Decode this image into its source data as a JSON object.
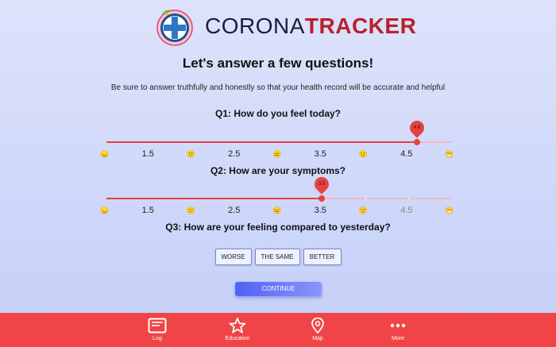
{
  "brand": {
    "part1": "CORONA",
    "part2": "TRACKER"
  },
  "heading": "Let's answer a few questions!",
  "subtitle": "Be sure to answer truthfully and honestly so that your health record will be accurate and helpful",
  "questions": [
    {
      "title": "Q1: How do you feel today?",
      "value": 4.6,
      "value_label": "4.6",
      "min": 1,
      "max": 5,
      "labels": [
        "😞",
        "1.5",
        "🙁",
        "2.5",
        "😐",
        "3.5",
        "🙂",
        "4.5",
        "😁"
      ],
      "label_values": [
        1,
        1.5,
        2,
        2.5,
        3,
        3.5,
        4,
        4.5,
        5
      ]
    },
    {
      "title": "Q2: How are your symptoms?",
      "value": 3.5,
      "value_label": "3.5",
      "min": 1,
      "max": 5,
      "labels": [
        "😞",
        "1.5",
        "🙁",
        "2.5",
        "😐",
        "3.5",
        "🙂",
        "4.5",
        "😁"
      ],
      "label_values": [
        1,
        1.5,
        2,
        2.5,
        3,
        3.5,
        4,
        4.5,
        5
      ]
    },
    {
      "title": "Q3: How are your feeling compared to yesterday?",
      "options": [
        "WORSE",
        "THE SAME",
        "BETTER"
      ]
    }
  ],
  "continue_label": "CONTINUE",
  "tabs": [
    {
      "label": "Log",
      "icon": "log-icon"
    },
    {
      "label": "Education",
      "icon": "star-icon"
    },
    {
      "label": "Map",
      "icon": "map-pin-icon"
    },
    {
      "label": "More",
      "icon": "more-dots-icon"
    }
  ],
  "colors": {
    "accent_red": "#e7413f",
    "tabbar_red": "#f04447",
    "brand_dark": "#1d1d3a",
    "brand_red": "#b8202d",
    "continue_blue": "#5161f5"
  }
}
